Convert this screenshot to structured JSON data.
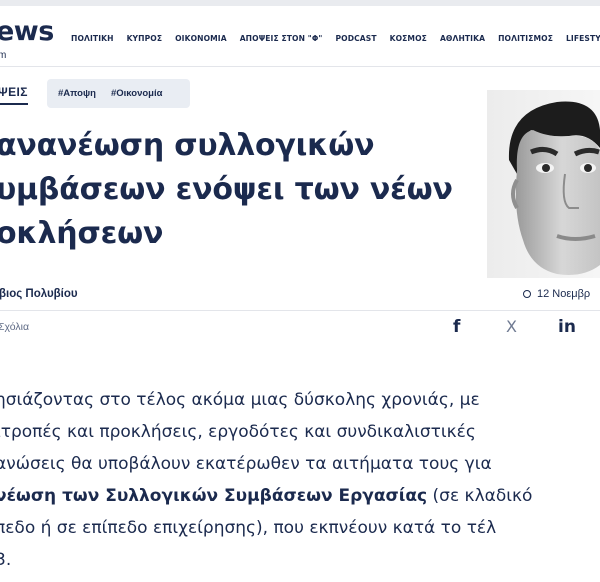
{
  "header": {
    "logo": "ews",
    "logo_sub": "m",
    "nav": [
      "ΠΟΛΙΤΙΚΗ",
      "ΚΥΠΡΟΣ",
      "ΟΙΚΟΝΟΜΙΑ",
      "ΑΠΟΨΕΙΣ ΣΤΟΝ \"Φ\"",
      "PODCAST",
      "ΚΟΣΜΟΣ",
      "ΑΘΛΗΤΙΚΑ",
      "ΠΟΛΙΤΙΣΜΟΣ",
      "LIFESTYL"
    ]
  },
  "article": {
    "category": "ΨΕΙΣ",
    "tags": [
      "#Αποψη",
      "#Οικονομία"
    ],
    "title_lines": [
      "ανανέωση συλλογικών",
      "υμβάσεων ενόψει των νέων",
      "οκλήσεων"
    ],
    "author": "βιος Πολυβίου",
    "date": "12 Νοεμβρ",
    "comments": "Σχόλια",
    "share": {
      "facebook": "f",
      "x": "X",
      "linkedin": "in"
    },
    "body": {
      "line1": "ησιάζοντας στο τέλος ακόμα μιας δύσκολης χρονιάς, με",
      "line2": "ιτροπές και προκλήσεις, εργοδότες και συνδικαλιστικές",
      "line3": "ανώσεις θα υποβάλουν εκατέρωθεν τα αιτήματα τους για",
      "line4_bold": "νέωση των Συλλογικών Συμβάσεων Εργασίας",
      "line4_rest": " (σε κλαδικό",
      "line5": "πεδο ή σε επίπεδο επιχείρησης), που εκπνέουν κατά το τέλ",
      "line6": "3."
    }
  }
}
